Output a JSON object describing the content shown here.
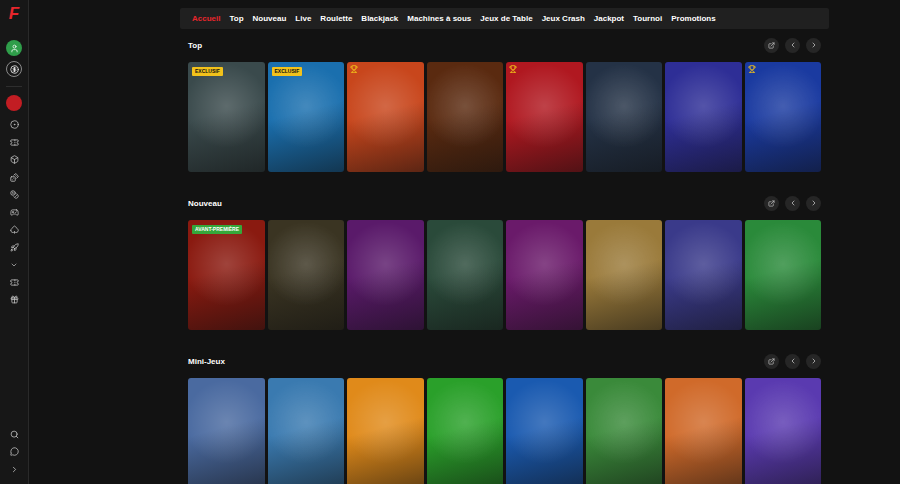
{
  "logo": "F",
  "nav": [
    {
      "label": "Accueil",
      "selected": true
    },
    {
      "label": "Top",
      "selected": false
    },
    {
      "label": "Nouveau",
      "selected": false
    },
    {
      "label": "Live",
      "selected": false
    },
    {
      "label": "Roulette",
      "selected": false
    },
    {
      "label": "Blackjack",
      "selected": false
    },
    {
      "label": "Machines à sous",
      "selected": false
    },
    {
      "label": "Jeux de Table",
      "selected": false
    },
    {
      "label": "Jeux Crash",
      "selected": false
    },
    {
      "label": "Jackpot",
      "selected": false
    },
    {
      "label": "Tournoi",
      "selected": false
    },
    {
      "label": "Promotions",
      "selected": false
    }
  ],
  "sections": [
    {
      "title": "Top",
      "tiles": [
        {
          "badge": "EXCLUSIF",
          "trophy": false,
          "color": "#3a4a4c"
        },
        {
          "badge": "EXCLUSIF",
          "trophy": false,
          "color": "#1a6fae"
        },
        {
          "trophy": true,
          "color": "#c8461c"
        },
        {
          "trophy": false,
          "color": "#5a2a10"
        },
        {
          "trophy": true,
          "color": "#b01820"
        },
        {
          "trophy": false,
          "color": "#243246"
        },
        {
          "trophy": false,
          "color": "#2e2e96"
        },
        {
          "trophy": true,
          "color": "#1a3aa0"
        }
      ]
    },
    {
      "title": "Nouveau",
      "tiles": [
        {
          "badge": "AVANT-PREMIÈRE",
          "trophy": false,
          "color": "#8a1a10"
        },
        {
          "trophy": false,
          "color": "#3a3422"
        },
        {
          "trophy": false,
          "color": "#5a1a6a"
        },
        {
          "trophy": false,
          "color": "#2a4a3a"
        },
        {
          "trophy": false,
          "color": "#6a1a6a"
        },
        {
          "trophy": false,
          "color": "#9a7a3a"
        },
        {
          "trophy": false,
          "color": "#3a3a8a"
        },
        {
          "trophy": false,
          "color": "#2a8a3a"
        }
      ]
    },
    {
      "title": "Mini-Jeux",
      "tiles": [
        {
          "trophy": false,
          "color": "#4a6aa0"
        },
        {
          "trophy": false,
          "color": "#3a7ab0"
        },
        {
          "trophy": false,
          "color": "#e08a1a"
        },
        {
          "trophy": false,
          "color": "#2aa02a"
        },
        {
          "trophy": false,
          "color": "#1a5ab0"
        },
        {
          "trophy": false,
          "color": "#3a8a3a"
        },
        {
          "trophy": false,
          "color": "#d06a2a"
        },
        {
          "trophy": false,
          "color": "#5a3ab0"
        }
      ]
    }
  ]
}
